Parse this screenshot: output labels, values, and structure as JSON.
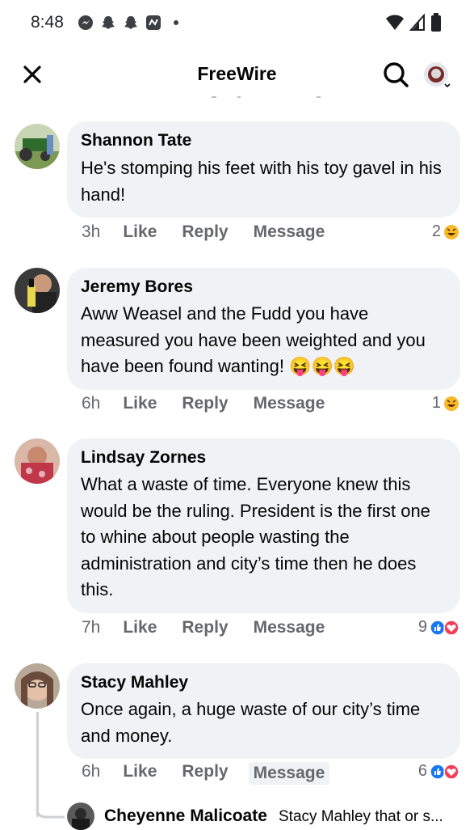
{
  "status_bar": {
    "time": "8:48"
  },
  "header": {
    "title": "FreeWire"
  },
  "comments": [
    {
      "author": "Shannon Tate",
      "text": "He's stomping his feet with his toy gavel in his hand!",
      "time": "3h",
      "like": "Like",
      "reply": "Reply",
      "message": "Message",
      "reaction_count": "2"
    },
    {
      "author": "Jeremy Bores",
      "text": "Aww Weasel and the Fudd you have measured you have been weighted and you have been found wanting! 😝😝😝",
      "time": "6h",
      "like": "Like",
      "reply": "Reply",
      "message": "Message",
      "reaction_count": "1"
    },
    {
      "author": "Lindsay Zornes",
      "text": "What a waste of time. Everyone knew this would be the ruling. President is the first one to whine about people wasting the administration and city’s time then he does this.",
      "time": "7h",
      "like": "Like",
      "reply": "Reply",
      "message": "Message",
      "reaction_count": "9"
    },
    {
      "author": "Stacy Mahley",
      "text": "Once again, a huge waste of our city’s time and money.",
      "time": "6h",
      "like": "Like",
      "reply": "Reply",
      "message": "Message",
      "reaction_count": "6"
    }
  ],
  "reply_preview": {
    "author": "Cheyenne Malicoate",
    "snippet": "Stacy Mahley that or s..."
  },
  "colors": {
    "like_blue": "#1877f2",
    "love_red": "#f33e58",
    "haha_yellow": "#f7b928"
  }
}
